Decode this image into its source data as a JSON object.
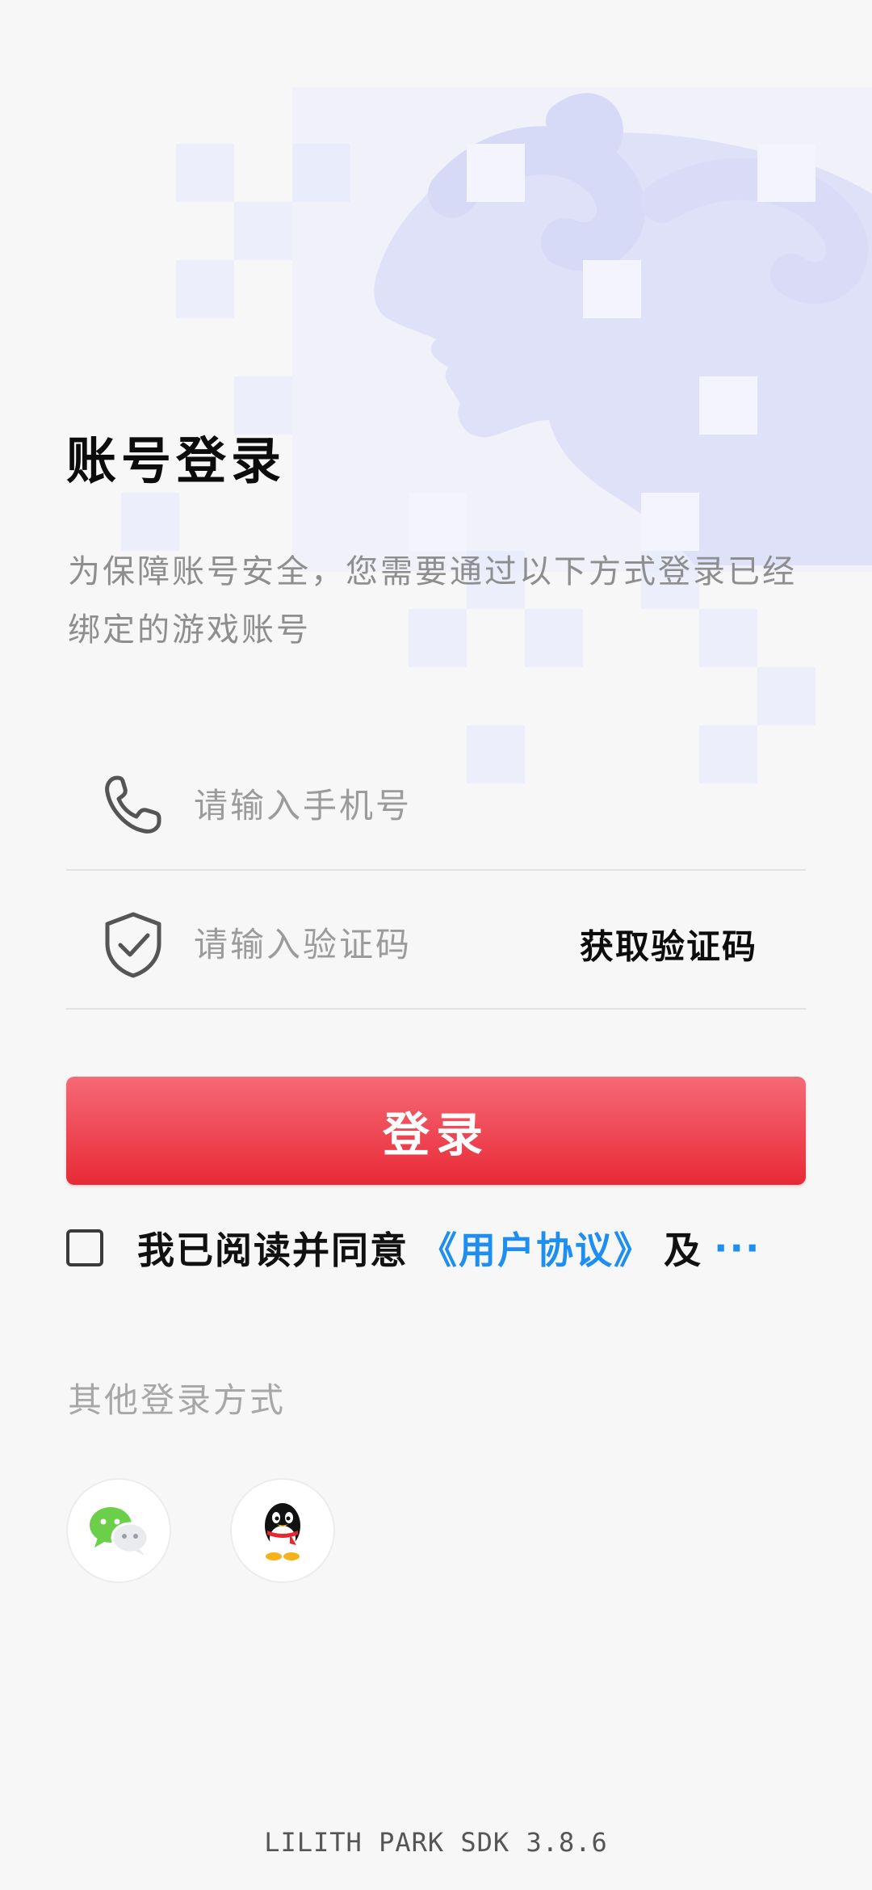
{
  "page": {
    "title": "账号登录",
    "subtitle": "为保障账号安全，您需要通过以下方式登录已经绑定的游戏账号"
  },
  "form": {
    "phone_placeholder": "请输入手机号",
    "code_placeholder": "请输入验证码",
    "get_code_label": "获取验证码",
    "login_label": "登录"
  },
  "agreement": {
    "prefix": "我已阅读并同意",
    "user_agreement_link": "《用户协议》",
    "and": "及",
    "more": "···"
  },
  "other_login": {
    "label": "其他登录方式",
    "options": [
      {
        "name": "WeChat",
        "icon": "wechat-icon"
      },
      {
        "name": "QQ",
        "icon": "qq-icon"
      }
    ]
  },
  "footer": {
    "version": "LILITH PARK SDK 3.8.6"
  },
  "colors": {
    "accent_red": "#e82a36",
    "link_blue": "#1f8ef1",
    "background": "#f7f7f7",
    "decor_purple": "#e5e7fb"
  }
}
